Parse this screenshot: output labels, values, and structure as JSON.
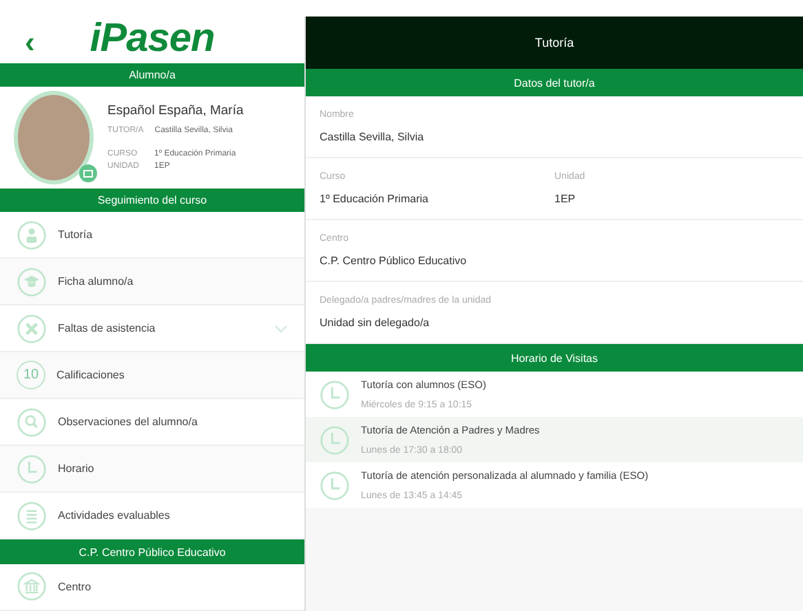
{
  "sidebar": {
    "back": "‹",
    "logo": "iPasen",
    "student_header": "Alumno/a",
    "student": {
      "name": "Español España, María",
      "fields": [
        {
          "label": "TUTOR/A",
          "value": "Castilla Sevilla, Silvia"
        },
        {
          "label": "CURSO",
          "value": "1º Educación Primaria"
        },
        {
          "label": "UNIDAD",
          "value": "1EP"
        }
      ]
    },
    "course_header": "Seguimiento del curso",
    "items": [
      {
        "label": "Tutoría",
        "kind": "person",
        "expandable": false
      },
      {
        "label": "Ficha alumno/a",
        "kind": "cap",
        "expandable": false
      },
      {
        "label": "Faltas de asistencia",
        "kind": "cross",
        "expandable": true
      },
      {
        "label": "Calificaciones",
        "kind": "number",
        "icon_text": "10",
        "expandable": false
      },
      {
        "label": "Observaciones del alumno/a",
        "kind": "search",
        "expandable": false
      },
      {
        "label": "Horario",
        "kind": "clock",
        "expandable": false
      },
      {
        "label": "Actividades evaluables",
        "kind": "list",
        "expandable": false
      }
    ],
    "school_header": "C.P. Centro Público Educativo",
    "school_items": [
      {
        "label": "Centro",
        "kind": "building",
        "expandable": false
      }
    ]
  },
  "main": {
    "title": "Tutoría",
    "section": "Datos del tutor/a",
    "rows": [
      [
        {
          "label": "Nombre",
          "value": "Castilla Sevilla, Silvia"
        }
      ],
      [
        {
          "label": "Curso",
          "value": "1º Educación Primaria"
        },
        {
          "label": "Unidad",
          "value": "1EP"
        }
      ],
      [
        {
          "label": "Centro",
          "value": "C.P. Centro Público Educativo"
        }
      ],
      [
        {
          "label": "Delegado/a padres/madres de la unidad",
          "value": "Unidad sin delegado/a"
        }
      ]
    ],
    "visits_header": "Horario de Visitas",
    "visits": [
      {
        "title": "Tutoría con alumnos (ESO)",
        "time": "Miércoles de 9:15 a 10:15"
      },
      {
        "title": "Tutoría de Atención a Padres y Madres",
        "time": "Lunes de 17:30 a 18:00"
      },
      {
        "title": "Tutoría de atención personalizada al alumnado y familia (ESO)",
        "time": "Lunes de 13:45 a 14:45"
      }
    ]
  }
}
